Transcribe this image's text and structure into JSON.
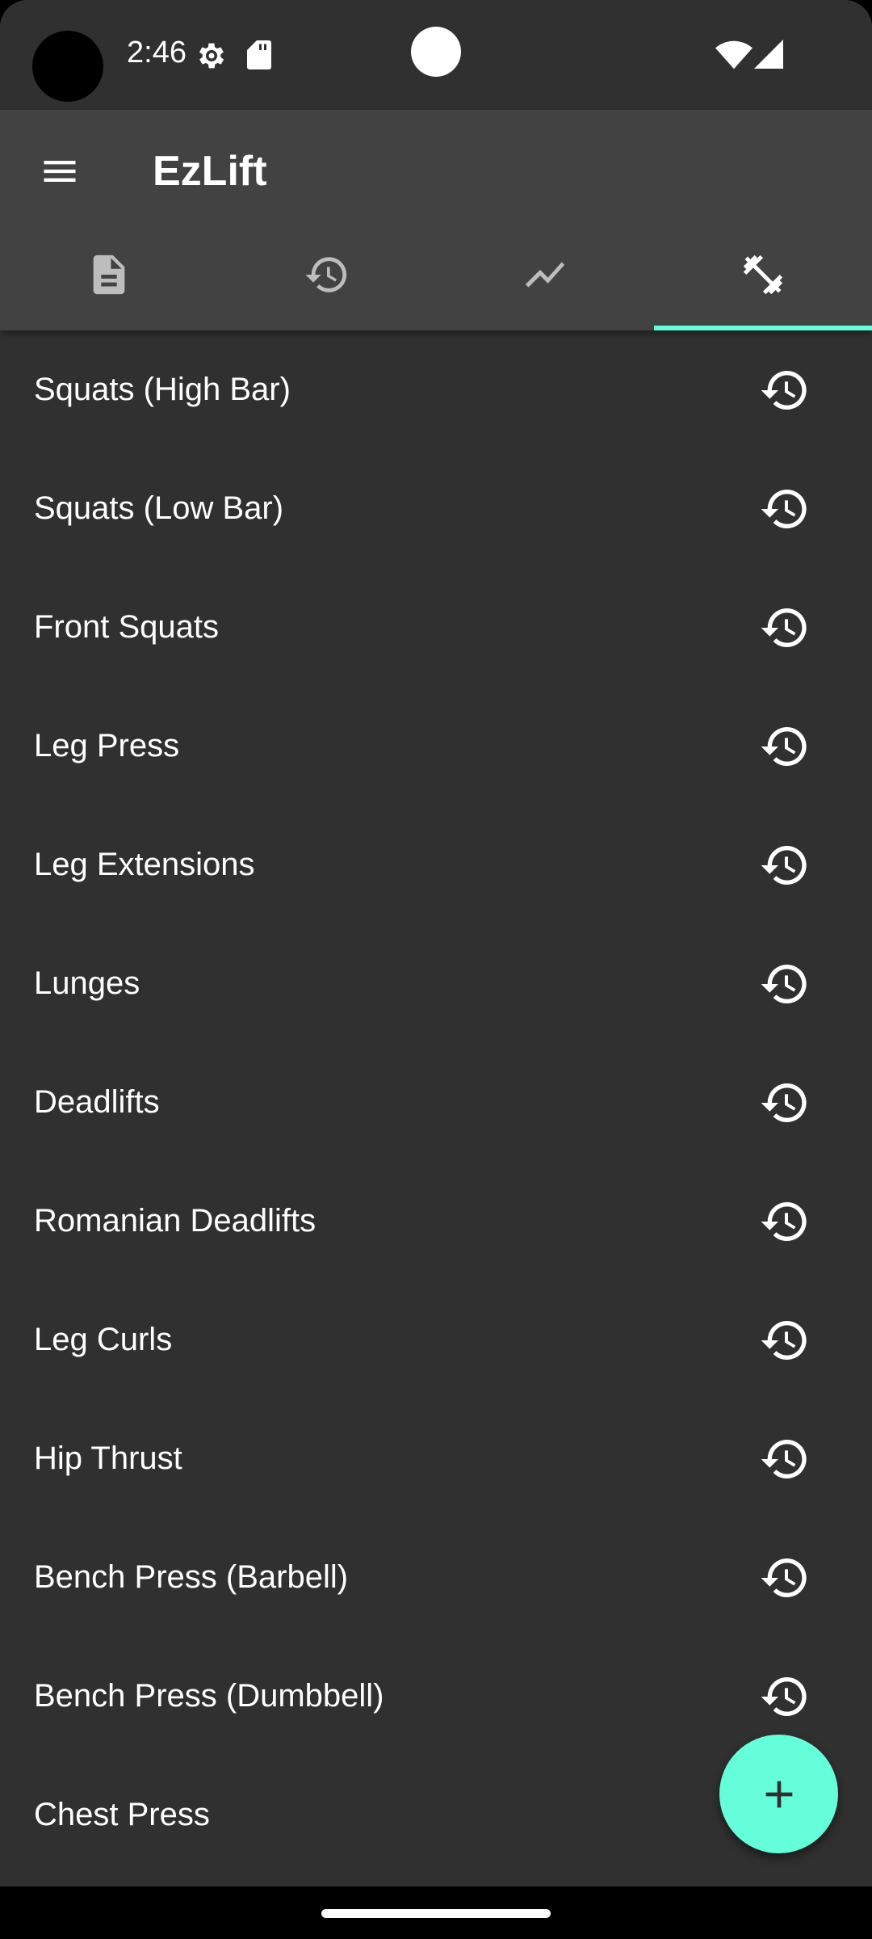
{
  "status_bar": {
    "time": "2:46",
    "icons": [
      "gear-icon",
      "sd-card-icon",
      "wifi-icon",
      "signal-icon"
    ]
  },
  "app_bar": {
    "title": "EzLift",
    "menu_icon": "menu-icon",
    "tabs": [
      {
        "icon": "document-icon",
        "selected": false
      },
      {
        "icon": "history-icon",
        "selected": false
      },
      {
        "icon": "trending-icon",
        "selected": false
      },
      {
        "icon": "dumbbell-icon",
        "selected": true
      }
    ]
  },
  "exercises": [
    {
      "name": "Squats (High Bar)"
    },
    {
      "name": "Squats (Low Bar)"
    },
    {
      "name": "Front Squats"
    },
    {
      "name": "Leg Press"
    },
    {
      "name": "Leg Extensions"
    },
    {
      "name": "Lunges"
    },
    {
      "name": "Deadlifts"
    },
    {
      "name": "Romanian Deadlifts"
    },
    {
      "name": "Leg Curls"
    },
    {
      "name": "Hip Thrust"
    },
    {
      "name": "Bench Press (Barbell)"
    },
    {
      "name": "Bench Press (Dumbbell)"
    },
    {
      "name": "Chest Press"
    }
  ],
  "fab": {
    "icon": "plus-icon"
  },
  "colors": {
    "background": "#303030",
    "app_bar": "#424242",
    "accent": "#64ffda",
    "inactive_icon": "#bdbdbd"
  }
}
